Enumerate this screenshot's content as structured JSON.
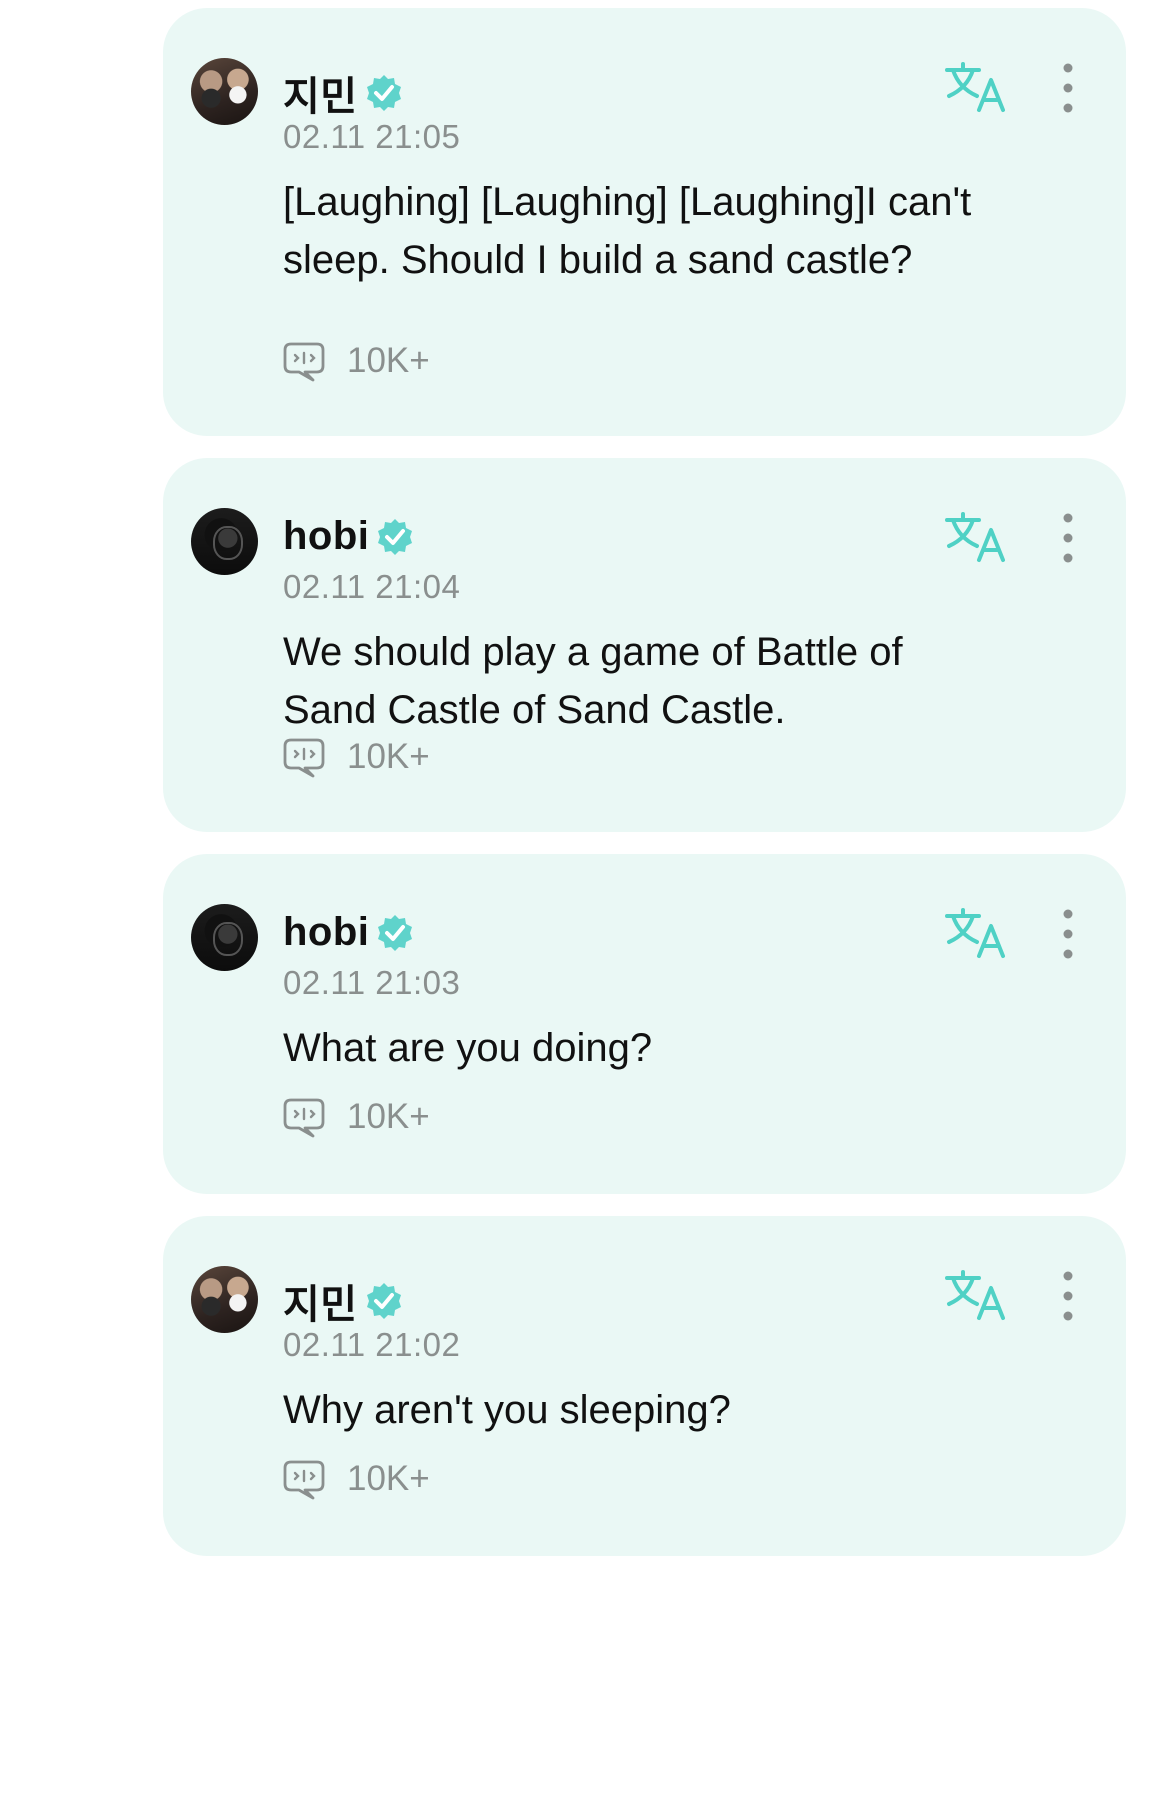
{
  "posts": [
    {
      "author": "지민",
      "timestamp": "02.11 21:05",
      "text": "[Laughing] [Laughing] [Laughing]I can't sleep. Should I build a sand castle?",
      "reply_count": "10K+",
      "avatar": "jimin-avatar"
    },
    {
      "author": "hobi",
      "timestamp": "02.11 21:04",
      "text": "We should play a game of Battle of Sand Castle of Sand Castle.",
      "reply_count": "10K+",
      "avatar": "hobi-avatar"
    },
    {
      "author": "hobi",
      "timestamp": "02.11 21:03",
      "text": "What are you doing?",
      "reply_count": "10K+",
      "avatar": "hobi-avatar"
    },
    {
      "author": "지민",
      "timestamp": "02.11 21:02",
      "text": "Why aren't you sleeping?",
      "reply_count": "10K+",
      "avatar": "jimin-avatar"
    }
  ],
  "icons": {
    "verified": "verified-badge-icon",
    "translate": "translate-icon",
    "more": "more-vertical-icon",
    "reply": "reply-bubble-icon"
  },
  "colors": {
    "card_bg": "#eaf8f5",
    "accent": "#4fd1c5",
    "muted_text": "#8a8f8e"
  }
}
